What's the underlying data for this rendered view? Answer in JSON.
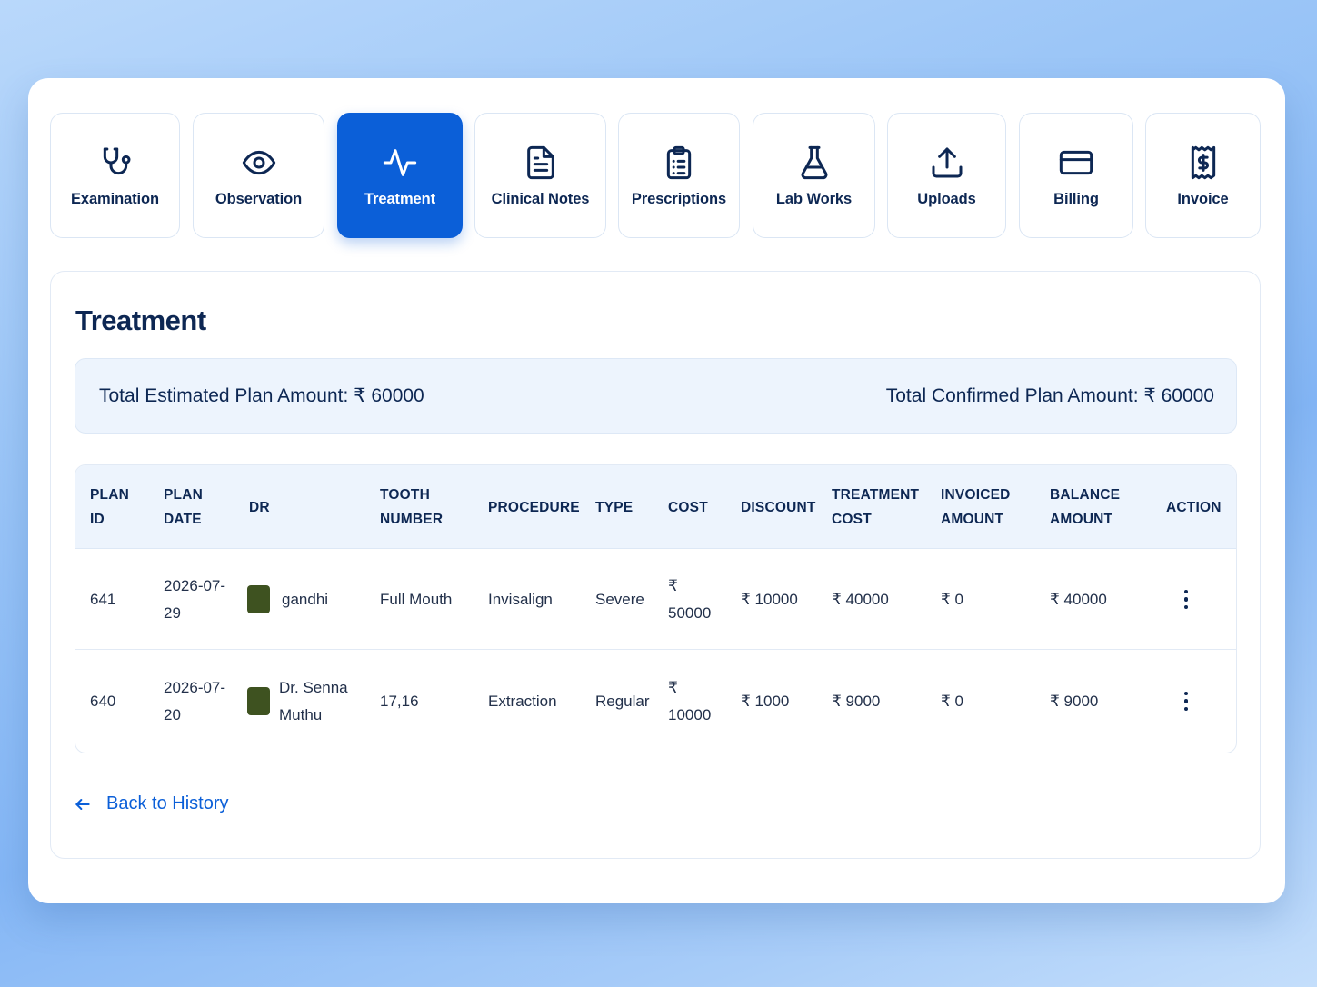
{
  "tabs": [
    {
      "label": "Examination",
      "icon": "stethoscope-icon",
      "active": false
    },
    {
      "label": "Observation",
      "icon": "eye-icon",
      "active": false
    },
    {
      "label": "Treatment",
      "icon": "activity-icon",
      "active": true
    },
    {
      "label": "Clinical Notes",
      "icon": "document-icon",
      "active": false
    },
    {
      "label": "Prescriptions",
      "icon": "clipboard-icon",
      "active": false
    },
    {
      "label": "Lab Works",
      "icon": "flask-icon",
      "active": false
    },
    {
      "label": "Uploads",
      "icon": "upload-icon",
      "active": false
    },
    {
      "label": "Billing",
      "icon": "credit-card-icon",
      "active": false
    },
    {
      "label": "Invoice",
      "icon": "receipt-icon",
      "active": false
    }
  ],
  "panel": {
    "title": "Treatment",
    "total_estimated": "Total Estimated Plan Amount: ₹ 60000",
    "total_confirmed": "Total Confirmed Plan Amount: ₹ 60000"
  },
  "table": {
    "headers": [
      [
        "PLAN",
        "ID"
      ],
      [
        "PLAN",
        "DATE"
      ],
      [
        "DR"
      ],
      [
        "TOOTH",
        "NUMBER"
      ],
      [
        "PROCEDURE"
      ],
      [
        "TYPE"
      ],
      [
        "COST"
      ],
      [
        "DISCOUNT"
      ],
      [
        "TREATMENT",
        "COST"
      ],
      [
        "INVOICED",
        "AMOUNT"
      ],
      [
        "BALANCE",
        "AMOUNT"
      ],
      [
        "ACTION"
      ]
    ],
    "rows": [
      {
        "plan_id": "641",
        "plan_date": [
          "2026-07-",
          "29"
        ],
        "dr": [
          "gandhi"
        ],
        "tooth_number": "Full Mouth",
        "procedure": "Invisalign",
        "type": "Severe",
        "cost": [
          "₹",
          "50000"
        ],
        "discount": "₹ 10000",
        "treatment_cost": "₹ 40000",
        "invoiced_amount": "₹ 0",
        "balance_amount": "₹ 40000"
      },
      {
        "plan_id": "640",
        "plan_date": [
          "2026-07-",
          "20"
        ],
        "dr": [
          "Dr. Senna",
          "Muthu"
        ],
        "tooth_number": "17,16",
        "procedure": "Extraction",
        "type": "Regular",
        "cost": [
          "₹",
          "10000"
        ],
        "discount": "₹ 1000",
        "treatment_cost": "₹ 9000",
        "invoiced_amount": "₹ 0",
        "balance_amount": "₹ 9000"
      }
    ]
  },
  "back_link": "Back to History",
  "colors": {
    "accent": "#0b5fd8",
    "text": "#0d2753",
    "header_bg": "#edf4fd",
    "avatar": "#3e5220"
  }
}
